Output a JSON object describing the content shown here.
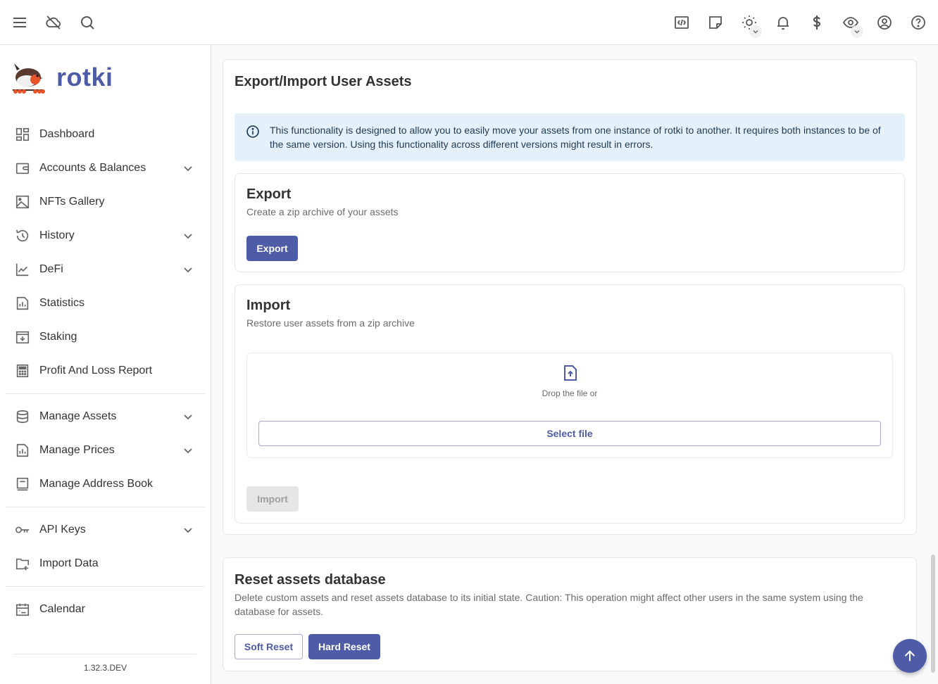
{
  "appbar": {
    "left_icons": [
      "menu-icon",
      "cloud-off-icon",
      "search-icon"
    ],
    "right_icons": [
      "code-icon",
      "sticky-note-icon",
      "theme-sun-icon",
      "bell-icon",
      "currency-dollar-icon",
      "eye-icon",
      "account-circle-icon",
      "help-icon"
    ]
  },
  "sidebar": {
    "brand": "rotki",
    "items": [
      {
        "label": "Dashboard",
        "icon": "dashboard-icon",
        "expandable": false
      },
      {
        "label": "Accounts & Balances",
        "icon": "wallet-icon",
        "expandable": true
      },
      {
        "label": "NFTs Gallery",
        "icon": "image-icon",
        "expandable": false
      },
      {
        "label": "History",
        "icon": "history-icon",
        "expandable": true
      },
      {
        "label": "DeFi",
        "icon": "line-chart-icon",
        "expandable": true
      },
      {
        "label": "Statistics",
        "icon": "bar-chart-icon",
        "expandable": false
      },
      {
        "label": "Staking",
        "icon": "archive-icon",
        "expandable": false
      },
      {
        "label": "Profit And Loss Report",
        "icon": "calculator-icon",
        "expandable": false
      },
      {
        "label": "Manage Assets",
        "icon": "database-icon",
        "expandable": true
      },
      {
        "label": "Manage Prices",
        "icon": "price-chart-icon",
        "expandable": true
      },
      {
        "label": "Manage Address Book",
        "icon": "book-icon",
        "expandable": false
      },
      {
        "label": "API Keys",
        "icon": "key-icon",
        "expandable": true
      },
      {
        "label": "Import Data",
        "icon": "folder-import-icon",
        "expandable": false
      },
      {
        "label": "Calendar",
        "icon": "calendar-icon",
        "expandable": false
      }
    ],
    "version": "1.32.3.DEV"
  },
  "main": {
    "title": "Export/Import User Assets",
    "alert": "This functionality is designed to allow you to easily move your assets from one instance of rotki to another. It requires both instances to be of the same version. Using this functionality across different versions might result in errors.",
    "export": {
      "title": "Export",
      "description": "Create a zip archive of your assets",
      "button": "Export"
    },
    "import": {
      "title": "Import",
      "description": "Restore user assets from a zip archive",
      "drop_text": "Drop the file or",
      "select_file": "Select file",
      "button": "Import",
      "button_disabled": true
    },
    "reset": {
      "title": "Reset assets database",
      "description": "Delete custom assets and reset assets database to its initial state. Caution: This operation might affect other users in the same system using the database for assets.",
      "soft_button": "Soft Reset",
      "hard_button": "Hard Reset"
    }
  },
  "colors": {
    "primary": "#4e5ba6",
    "alert_bg": "#e5f1fa",
    "alert_text": "#1d3a52"
  }
}
